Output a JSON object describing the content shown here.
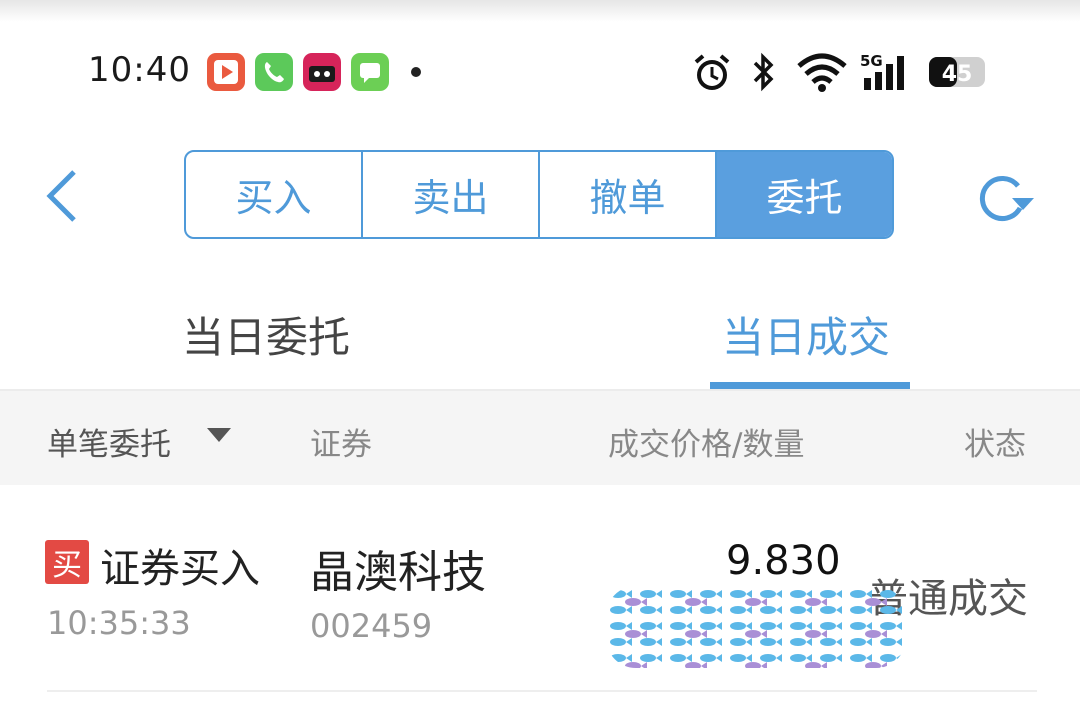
{
  "status_bar": {
    "time": "10:40",
    "battery": "45",
    "network": "5G",
    "icons": [
      "video-app-icon",
      "phone-app-icon",
      "tmall-app-icon",
      "messages-app-icon",
      "alarm-icon",
      "bluetooth-icon",
      "wifi-icon",
      "signal-icon",
      "battery-icon"
    ],
    "colors": {
      "video": "#e9553a",
      "phone": "#59c95a",
      "messages": "#6ccf55",
      "tmall": "#d4235a"
    }
  },
  "nav": {
    "tabs": [
      "买入",
      "卖出",
      "撤单",
      "委托"
    ],
    "active_tab": "委托",
    "back_icon": "chevron-left-icon",
    "refresh_icon": "refresh-icon",
    "accent": "#4f9ad9"
  },
  "subtabs": [
    "当日委托",
    "当日成交"
  ],
  "active_subtab": "当日成交",
  "columns": {
    "c1": "单笔委托",
    "c2": "证券",
    "c3": "成交价格/数量",
    "c4": "状态"
  },
  "rows": [
    {
      "badge": "买",
      "type": "证券买入",
      "time": "10:35:33",
      "name": "晶澳科技",
      "code": "002459",
      "price": "9.830",
      "status": "普通成交"
    }
  ]
}
